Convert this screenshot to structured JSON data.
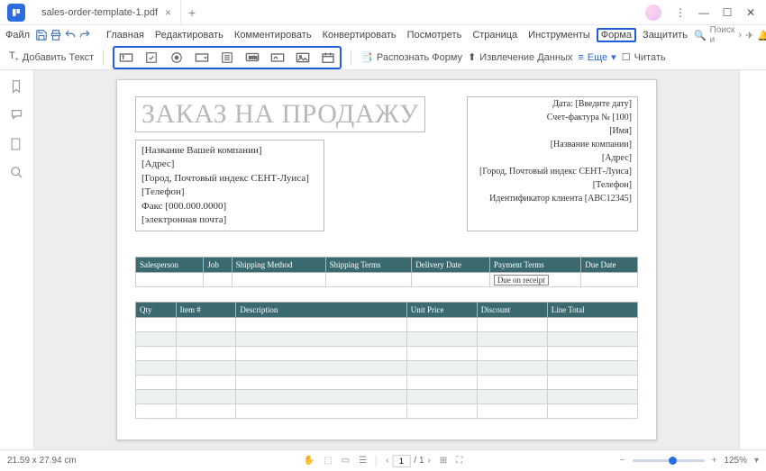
{
  "titlebar": {
    "tab_name": "sales-order-template-1.pdf"
  },
  "menubar": {
    "file": "Файл",
    "items": [
      "Главная",
      "Редактировать",
      "Комментировать",
      "Конвертировать",
      "Посмотреть",
      "Страница",
      "Инструменты",
      "Форма",
      "Защитить"
    ],
    "active_index": 7,
    "search_placeholder": "Поиск и"
  },
  "toolbar": {
    "add_text": "Добавить Текст",
    "recognize_form": "Распознать Форму",
    "data_extraction": "Извлечение Данных",
    "more": "Еще",
    "read": "Читать"
  },
  "document": {
    "title": "ЗАКАЗ НА ПРОДАЖУ",
    "company_lines": [
      "[Название Вашей компании]",
      "[Адрес]",
      "[Город, Почтовый индекс СЕНТ-Луиса]",
      "[Телефон]",
      "Факс [000.000.0000]",
      "[электронная почта]"
    ],
    "meta_lines": [
      "Дата: [Введите дату]",
      "Счет-фактура № [100]",
      "[Имя]",
      "[Название компании]",
      "[Адрес]",
      "[Город, Почтовый индекс СЕНТ-Луиса]",
      "[Телефон]",
      "Идентификатор клиента [ABC12345]"
    ],
    "order_headers": [
      "Salesperson",
      "Job",
      "Shipping Method",
      "Shipping Terms",
      "Delivery Date",
      "Payment Terms",
      "Due Date"
    ],
    "payment_terms_value": "Due on receipt",
    "item_headers": [
      "Qty",
      "Item #",
      "Description",
      "Unit Price",
      "Discount",
      "Line Total"
    ]
  },
  "statusbar": {
    "dimensions": "21.59 x 27.94 cm",
    "page_current": "1",
    "page_total": "/ 1",
    "zoom": "125%"
  }
}
